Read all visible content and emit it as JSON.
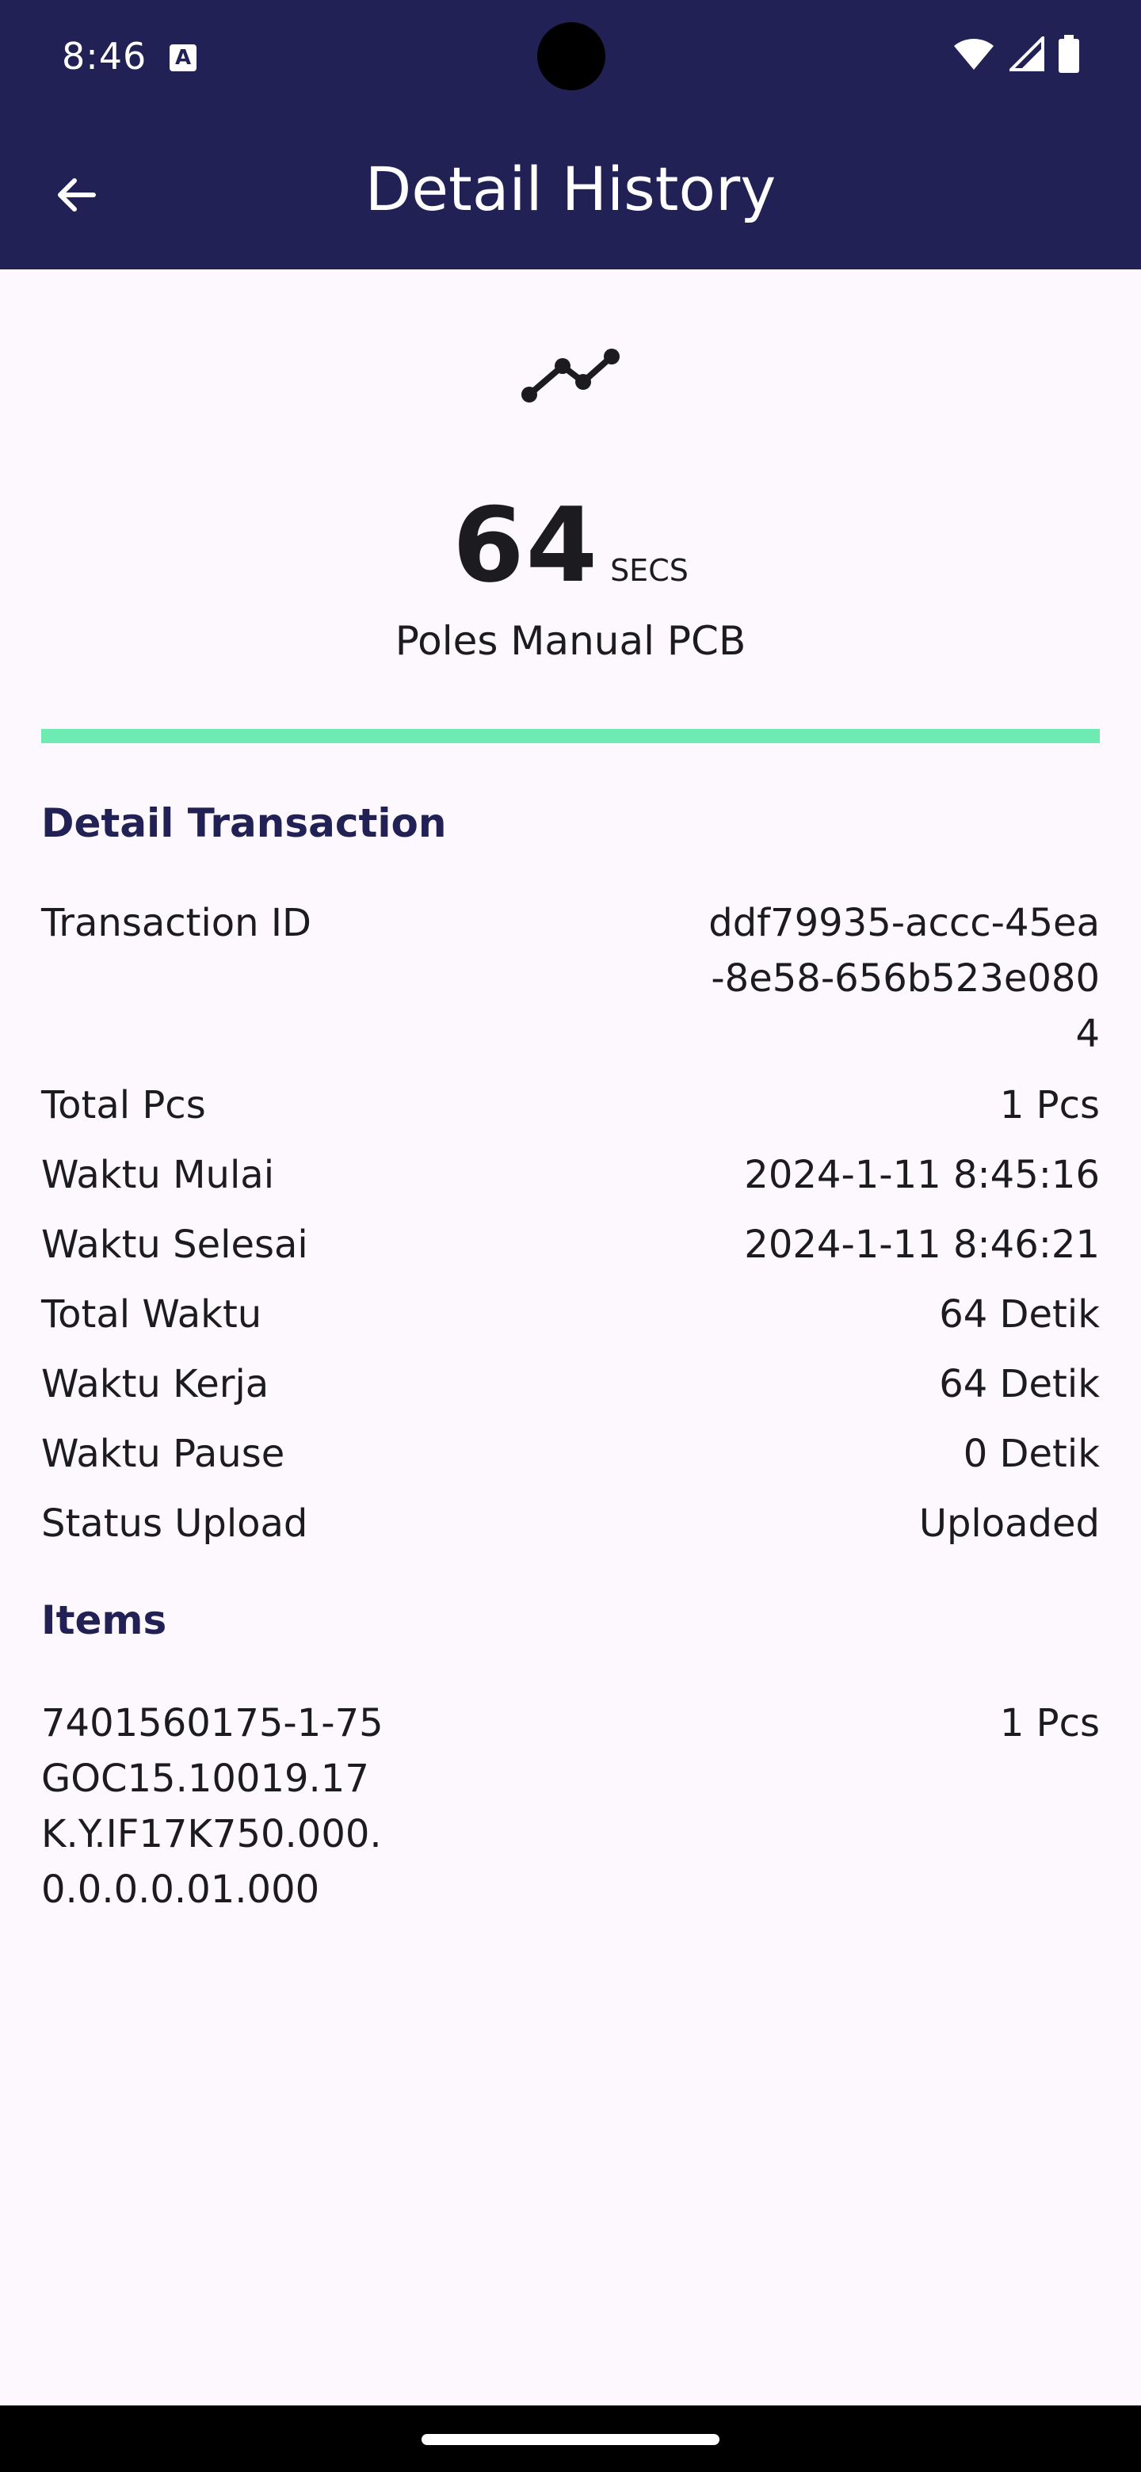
{
  "status_bar": {
    "time": "8:46",
    "notification_icon": "a-icon",
    "icons": [
      "wifi-icon",
      "signal-icon",
      "battery-icon"
    ]
  },
  "app_bar": {
    "title": "Detail History",
    "back_icon": "arrow-left-icon"
  },
  "summary": {
    "icon": "trending-line-icon",
    "duration_value": "64",
    "duration_unit": "SECS",
    "process_name": "Poles Manual PCB",
    "progress_color": "#6eebb2"
  },
  "detail_transaction": {
    "heading": "Detail Transaction",
    "rows": [
      {
        "label": "Transaction ID",
        "value": "ddf79935-accc-45ea-8e58-656b523e0804"
      },
      {
        "label": "Total Pcs",
        "value": "1 Pcs"
      },
      {
        "label": "Waktu Mulai",
        "value": "2024-1-11 8:45:16"
      },
      {
        "label": "Waktu Selesai",
        "value": "2024-1-11 8:46:21"
      },
      {
        "label": "Total Waktu",
        "value": "64 Detik"
      },
      {
        "label": "Waktu Kerja",
        "value": "64 Detik"
      },
      {
        "label": "Waktu Pause",
        "value": "0 Detik"
      },
      {
        "label": "Status Upload",
        "value": "Uploaded"
      }
    ]
  },
  "items": {
    "heading": "Items",
    "list": [
      {
        "code": "7401560175-1-75GOC15.10019.17K.Y.IF17K750.000.0.0.0.0.01.000",
        "qty": "1 Pcs"
      }
    ]
  },
  "colors": {
    "primary": "#222155",
    "accent": "#6eebb2",
    "background": "#fdf8fd"
  }
}
